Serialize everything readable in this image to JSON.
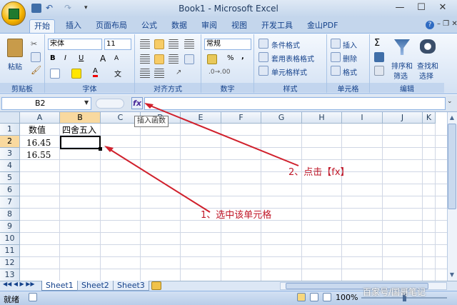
{
  "window": {
    "title": "Book1 - Microsoft Excel"
  },
  "tabs": [
    "开始",
    "插入",
    "页面布局",
    "公式",
    "数据",
    "审阅",
    "视图",
    "开发工具",
    "金山PDF"
  ],
  "ribbon": {
    "paste_label": "粘贴",
    "font_name": "宋体",
    "font_size": "11",
    "number_format": "常规",
    "styles": [
      "条件格式",
      "套用表格格式",
      "单元格样式"
    ],
    "cells": [
      "插入",
      "删除",
      "格式"
    ],
    "sum_symbol": "Σ",
    "sort_filter": "排序和\n筛选",
    "find_select": "查找和\n选择",
    "sort_label_1": "排序和",
    "sort_label_2": "筛选",
    "find_label_1": "查找和",
    "find_label_2": "选择",
    "groups": [
      "剪贴板",
      "字体",
      "对齐方式",
      "数字",
      "样式",
      "单元格",
      "编辑"
    ],
    "bold": "B",
    "italic": "I",
    "underline": "U",
    "grow": "A",
    "shrink": "A",
    "fontcolor": "A",
    "wen": "文",
    "pct": "%",
    "comma": ","
  },
  "formula_bar": {
    "name_box": "B2",
    "fx": "fx",
    "tooltip": "插入函数"
  },
  "grid": {
    "columns": [
      "A",
      "B",
      "C",
      "D",
      "E",
      "F",
      "G",
      "H",
      "I",
      "J",
      "K"
    ],
    "rows": [
      "1",
      "2",
      "3",
      "4",
      "5",
      "6",
      "7",
      "8",
      "9",
      "10",
      "11",
      "12",
      "13"
    ],
    "a1": "数值",
    "b1": "四舍五入",
    "a2": "16.45",
    "a3": "16.55"
  },
  "sheets": [
    "Sheet1",
    "Sheet2",
    "Sheet3"
  ],
  "status": {
    "mode": "就绪",
    "zoom": "100%"
  },
  "annotations": {
    "step1": "1、选中该单元格",
    "step2": "2、点击【fx】"
  },
  "watermark": "百家号/国哥笔记",
  "colors": {
    "annotation": "#d0202c",
    "accent": "#15428b",
    "selected_header": "#f9d99f"
  }
}
